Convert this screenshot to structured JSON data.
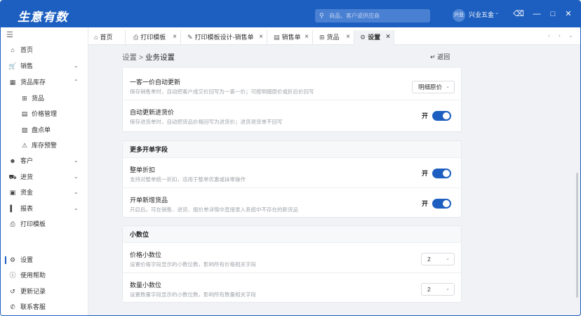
{
  "titlebar": {
    "logo": "生意有数",
    "search_placeholder": "商品、客户或供应商",
    "avatar_text": "兴业",
    "shop_name": "兴业五金",
    "icons": [
      "clear-icon",
      "minimize-icon",
      "maximize-icon",
      "close-icon"
    ]
  },
  "sidebar": {
    "items": [
      {
        "label": "首页",
        "icon": "home-icon"
      },
      {
        "label": "销售",
        "icon": "cart-icon"
      },
      {
        "label": "货品库存",
        "icon": "inventory-icon"
      },
      {
        "label": "货品",
        "icon": "grid-icon"
      },
      {
        "label": "价格管理",
        "icon": "price-icon"
      },
      {
        "label": "盘点单",
        "icon": "clipboard-icon"
      },
      {
        "label": "库存预警",
        "icon": "warning-icon"
      },
      {
        "label": "客户",
        "icon": "users-icon"
      },
      {
        "label": "进货",
        "icon": "truck-icon"
      },
      {
        "label": "资金",
        "icon": "wallet-icon"
      },
      {
        "label": "报表",
        "icon": "chart-icon"
      },
      {
        "label": "打印模板",
        "icon": "printer-icon"
      }
    ],
    "bottom": [
      {
        "label": "设置",
        "icon": "gear-icon"
      },
      {
        "label": "使用帮助",
        "icon": "help-icon"
      },
      {
        "label": "更新记录",
        "icon": "history-icon"
      },
      {
        "label": "联系客服",
        "icon": "chat-icon"
      }
    ]
  },
  "tabs": [
    {
      "label": "首页",
      "icon": "home-icon"
    },
    {
      "label": "打印模板",
      "icon": "printer-icon"
    },
    {
      "label": "打印模板设计-销售单",
      "icon": "edit-icon"
    },
    {
      "label": "销售单",
      "icon": "document-icon"
    },
    {
      "label": "货品",
      "icon": "grid-icon"
    },
    {
      "label": "设置",
      "icon": "gear-icon"
    }
  ],
  "breadcrumb": {
    "parent": "设置",
    "separator": ">",
    "current": "业务设置"
  },
  "back_label": "返回",
  "sections": {
    "top": {
      "rows": [
        {
          "title": "一客一价自动更新",
          "desc": "保存销售单时，自动把客户成交价回写为一客一价；可按明细原价或折后价回写",
          "select": "明细原价"
        },
        {
          "title": "自动更新进货价",
          "desc": "保存进货单时，自动把货品价格回写为进货价；进货退货单不回写",
          "toggle": "开"
        }
      ]
    },
    "more": {
      "title": "更多开单字段",
      "rows": [
        {
          "title": "整单折扣",
          "desc": "支持对整单统一折扣，适用于整单优惠或抹零操作",
          "toggle": "开"
        },
        {
          "title": "开单新增货品",
          "desc": "开启后，可在销售、进货、报价单详情中直接录入系统中不存在的新货品",
          "toggle": "开"
        }
      ]
    },
    "decimal": {
      "title": "小数位",
      "rows": [
        {
          "title": "价格小数位",
          "desc": "设置价格字段显示的小数位数，影响所有价格相关字段",
          "select": "2"
        },
        {
          "title": "数量小数位",
          "desc": "设置数量字段显示的小数位数，影响所有数量相关字段",
          "select": "2"
        }
      ]
    }
  },
  "colors": {
    "brand": "#1d5fc0",
    "bg": "#f0f2f5"
  }
}
